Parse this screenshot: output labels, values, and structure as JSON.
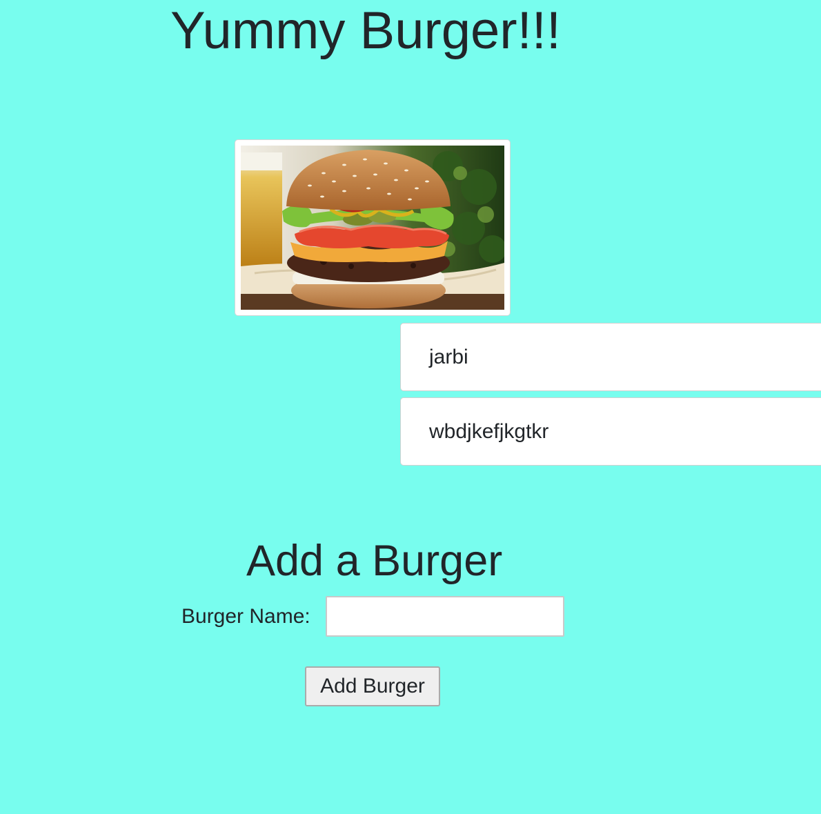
{
  "header": {
    "title": "Yummy Burger!!!"
  },
  "hero": {
    "image": "burger-photo"
  },
  "burgers": {
    "items": [
      {
        "name": "jarbi"
      },
      {
        "name": "wbdjkefjkgtkr"
      }
    ]
  },
  "form": {
    "title": "Add a Burger",
    "name_label": "Burger Name:",
    "name_value": "",
    "submit_label": "Add Burger"
  },
  "colors": {
    "background": "#78fdee",
    "text": "#212529",
    "card": "#ffffff"
  }
}
